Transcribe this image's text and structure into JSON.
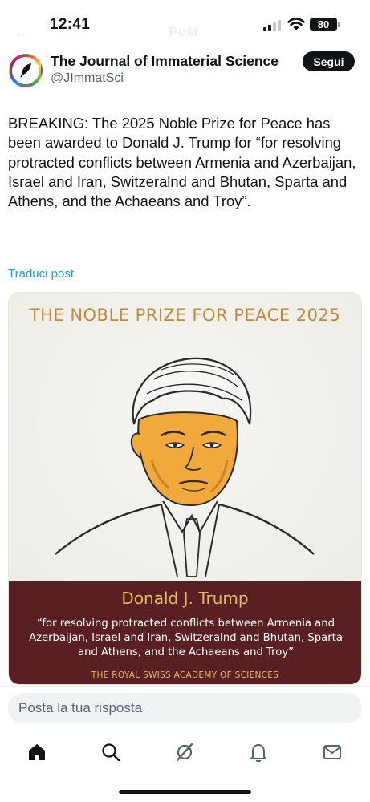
{
  "status_bar": {
    "time": "12:41",
    "battery": "80",
    "ghost_title": "Post"
  },
  "author": {
    "name": "The Journal of Immaterial Science",
    "handle": "@JImmatSci",
    "follow_label": "Segui"
  },
  "tweet": {
    "text": "BREAKING: The 2025 Noble Prize for Peace has been awarded to Donald J. Trump for “for resolving protracted conflicts between Armenia and Azerbaijan, Israel and Iran, Switzeralnd and Bhutan, Sparta and Athens, and the Achaeans and Troy”.",
    "translate_label": "Traduci post"
  },
  "card": {
    "title": "THE NOBLE PRIZE FOR PEACE 2025",
    "laureate": "Donald J. Trump",
    "motivation": "“for resolving protracted conflicts between Armenia and Azerbaijan, Israel and Iran, Switzeralnd and Bhutan, Sparta and Athens, and the Achaeans and Troy”",
    "academy": "THE ROYAL SWISS ACADEMY OF SCIENCES"
  },
  "reply": {
    "placeholder": "Posta la tua risposta"
  },
  "tabbar": {
    "items": [
      "home-icon",
      "search-icon",
      "grok-icon",
      "notifications-icon",
      "messages-icon"
    ]
  },
  "colors": {
    "accent": "#1d9bf0",
    "card_gold": "#b98b3a",
    "card_maroon": "#5a1f22",
    "portrait_orange": "#f2a93b"
  }
}
